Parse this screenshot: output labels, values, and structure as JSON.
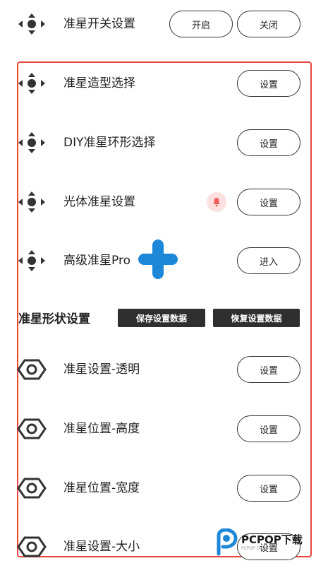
{
  "top_row": {
    "label": "准星开关设置",
    "on_label": "开启",
    "off_label": "关闭"
  },
  "rows": [
    {
      "label": "准星造型选择",
      "button": "设置",
      "icon": "move-arrows-icon"
    },
    {
      "label": "DIY准星环形选择",
      "button": "设置",
      "icon": "move-arrows-icon"
    },
    {
      "label": "光体准星设置",
      "button": "设置",
      "icon": "move-arrows-icon"
    },
    {
      "label": "高级准星Pro",
      "button": "进入",
      "icon": "move-arrows-icon"
    }
  ],
  "section": {
    "title": "准星形状设置",
    "save_label": "保存设置数据",
    "restore_label": "恢复设置数据"
  },
  "shape_rows": [
    {
      "label": "准星设置-透明",
      "button": "设置",
      "icon": "hex-nut-icon"
    },
    {
      "label": "准星位置-高度",
      "button": "设置",
      "icon": "hex-nut-icon"
    },
    {
      "label": "准星位置-宽度",
      "button": "设置",
      "icon": "hex-nut-icon"
    },
    {
      "label": "准星设置-大小",
      "button": "设置",
      "icon": "hex-nut-icon"
    }
  ],
  "watermark": {
    "brand": "PCPOP下载",
    "sub": "PCPOP Download"
  },
  "colors": {
    "highlight_frame": "#e8463d",
    "plus_badge": "#1e88d8",
    "dark_button": "#2f2f2f"
  }
}
